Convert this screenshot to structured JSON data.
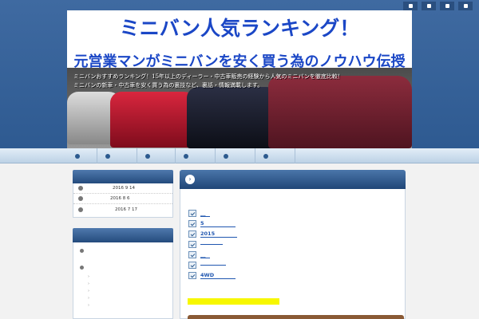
{
  "header": {
    "title": "ミニバン人気ランキング！",
    "subtitle": "元営業マンがミニバンを安く買う為のノウハウ伝授",
    "description_line1": "ミニバンおすすめランキング！15年以上のディーラー・中古車販売の経験から人気のミニバンを徹底比較！",
    "description_line2": "ミニバンの新車・中古車を安く買う為の裏技など、裏話・情報満載します。",
    "top_icons": [
      "home-icon",
      "rss-icon",
      "user-icon",
      "mail-icon"
    ]
  },
  "nav": {
    "items": [
      "",
      "",
      "",
      "",
      "",
      ""
    ]
  },
  "sidebar": {
    "archives": [
      "2016 9 14",
      "2016 8 6",
      "2016 7 17"
    ],
    "categories": [
      {
        "label": "",
        "children": []
      },
      {
        "label": "",
        "children": [
          "",
          "",
          "",
          "",
          ""
        ]
      }
    ]
  },
  "main": {
    "posts": [
      "__",
      "5",
      "2015",
      "",
      "__",
      "",
      "4WD"
    ]
  },
  "colors": {
    "header_blue": "#3f6aa1",
    "title_blue": "#1b47c6",
    "link_blue": "#1f56b0",
    "highlight": "#f7f700"
  }
}
